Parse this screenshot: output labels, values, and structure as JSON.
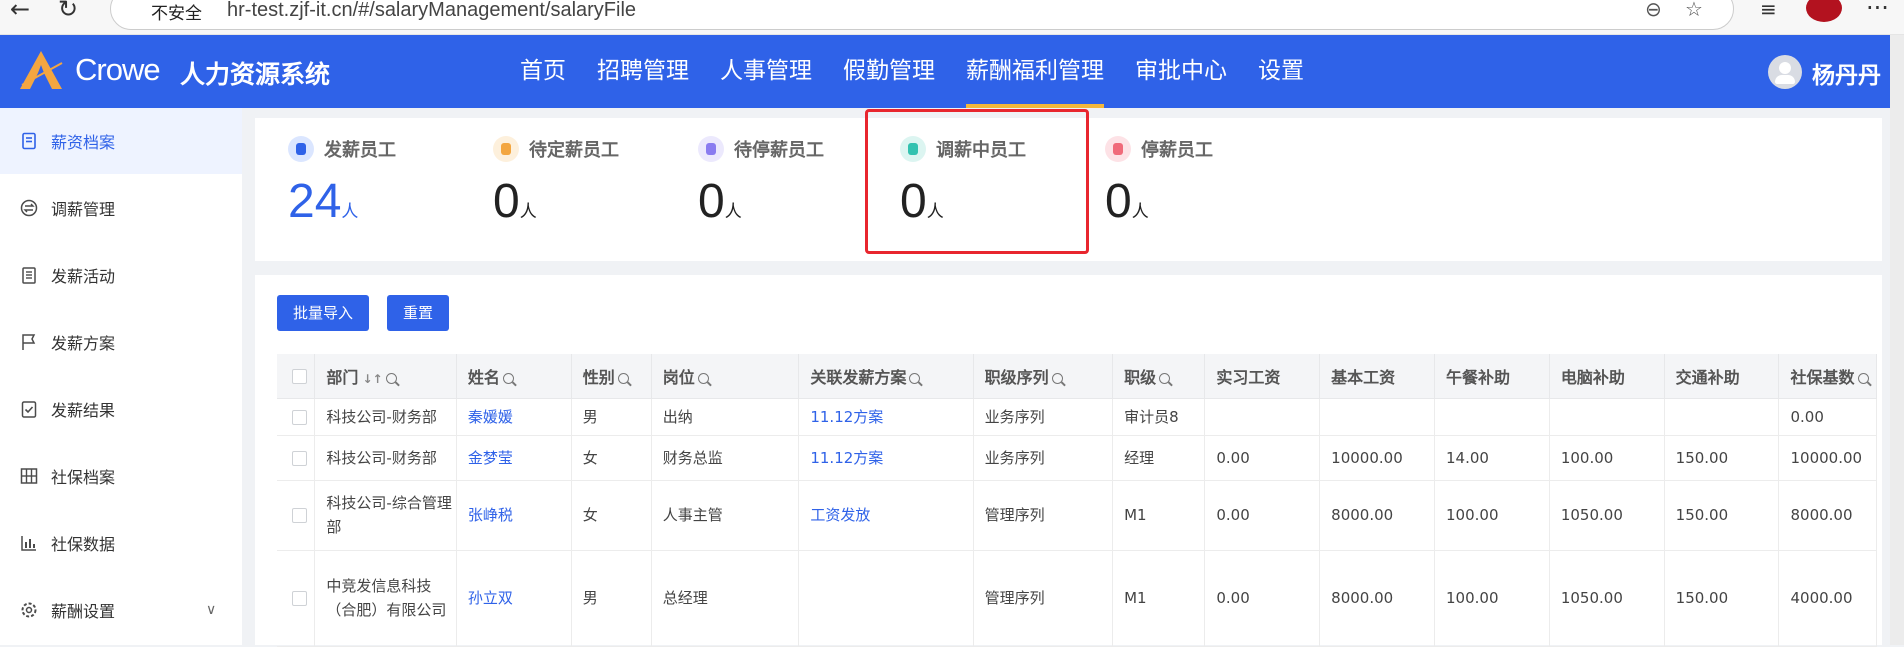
{
  "browser": {
    "security_label": "不安全",
    "url": "hr-test.zjf-it.cn/#/salaryManagement/salaryFile"
  },
  "app": {
    "brand": "Crowe",
    "system_name": "人力资源系统",
    "menu": [
      {
        "label": "首页",
        "active": false
      },
      {
        "label": "招聘管理",
        "active": false
      },
      {
        "label": "人事管理",
        "active": false
      },
      {
        "label": "假勤管理",
        "active": false
      },
      {
        "label": "薪酬福利管理",
        "active": true
      },
      {
        "label": "审批中心",
        "active": false
      },
      {
        "label": "设置",
        "active": false
      }
    ],
    "user_name": "杨丹丹"
  },
  "sidebar": {
    "items": [
      {
        "label": "薪资档案",
        "icon": "document-icon",
        "active": true
      },
      {
        "label": "调薪管理",
        "icon": "exchange-icon",
        "active": false
      },
      {
        "label": "发薪活动",
        "icon": "clipboard-icon",
        "active": false
      },
      {
        "label": "发薪方案",
        "icon": "flag-icon",
        "active": false
      },
      {
        "label": "发薪结果",
        "icon": "check-clipboard-icon",
        "active": false
      },
      {
        "label": "社保档案",
        "icon": "grid-icon",
        "active": false
      },
      {
        "label": "社保数据",
        "icon": "bar-chart-icon",
        "active": false
      },
      {
        "label": "薪酬设置",
        "icon": "gear-icon",
        "active": false,
        "expandable": true
      }
    ]
  },
  "stats": [
    {
      "title": "发薪员工",
      "value": "24",
      "unit": "人",
      "color": "#2f62e8"
    },
    {
      "title": "待定薪员工",
      "value": "0",
      "unit": "人",
      "color": "#f3a640"
    },
    {
      "title": "待停薪员工",
      "value": "0",
      "unit": "人",
      "color": "#8a7cf0"
    },
    {
      "title": "调薪中员工",
      "value": "0",
      "unit": "人",
      "color": "#33c2b0"
    },
    {
      "title": "停薪员工",
      "value": "0",
      "unit": "人",
      "color": "#f06a7a"
    }
  ],
  "toolbar": {
    "import_label": "批量导入",
    "reset_label": "重置"
  },
  "table": {
    "headers": [
      "部门",
      "姓名",
      "性别",
      "岗位",
      "关联发薪方案",
      "职级序列",
      "职级",
      "实习工资",
      "基本工资",
      "午餐补助",
      "电脑补助",
      "交通补助",
      "社保基数"
    ],
    "rows": [
      [
        "科技公司-财务部",
        "秦媛媛",
        "男",
        "出纳",
        "11.12方案",
        "业务序列",
        "审计员8",
        "",
        "",
        "",
        "",
        "",
        "0.00"
      ],
      [
        "科技公司-财务部",
        "金梦莹",
        "女",
        "财务总监",
        "11.12方案",
        "业务序列",
        "经理",
        "0.00",
        "10000.00",
        "14.00",
        "100.00",
        "150.00",
        "10000.00"
      ],
      [
        "科技公司-综合管理部",
        "张峥税",
        "女",
        "人事主管",
        "工资发放",
        "管理序列",
        "M1",
        "0.00",
        "8000.00",
        "100.00",
        "1050.00",
        "150.00",
        "8000.00"
      ],
      [
        "中竞发信息科技（合肥）有限公司",
        "孙立双",
        "男",
        "总经理",
        "",
        "管理序列",
        "M1",
        "0.00",
        "8000.00",
        "100.00",
        "1050.00",
        "150.00",
        "4000.00"
      ]
    ]
  }
}
